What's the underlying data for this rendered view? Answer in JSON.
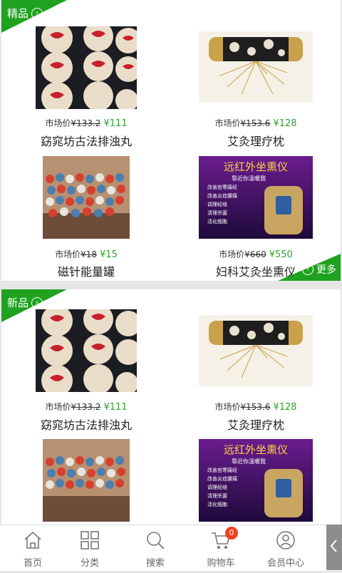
{
  "sections": [
    {
      "label": "精品",
      "more_label": "更多",
      "items": [
        {
          "market_label": "市场价",
          "old_price": "¥133.2",
          "price": "¥111",
          "name": "窈窕坊古法排浊丸",
          "image": "pills-image"
        },
        {
          "market_label": "市场价",
          "old_price": "¥153.6",
          "price": "¥128",
          "name": "艾灸理疗枕",
          "image": "pillow-image"
        },
        {
          "market_label": "市场价",
          "old_price": "¥18",
          "price": "¥15",
          "name": "磁针能量罐",
          "image": "cups-image"
        },
        {
          "market_label": "市场价",
          "old_price": "¥660",
          "price": "¥550",
          "name": "妇科艾灸坐熏仪",
          "image": "device-image"
        }
      ]
    },
    {
      "label": "新品",
      "items": [
        {
          "market_label": "市场价",
          "old_price": "¥133.2",
          "price": "¥111",
          "name": "窈窕坊古法排浊丸",
          "image": "pills-image"
        },
        {
          "market_label": "市场价",
          "old_price": "¥153.6",
          "price": "¥128",
          "name": "艾灸理疗枕",
          "image": "pillow-image"
        },
        {
          "image": "cups-image"
        },
        {
          "image": "device-image"
        }
      ]
    }
  ],
  "promo": {
    "title": "远红外坐熏仪",
    "subtitle": "靠近你温暖我",
    "features": [
      "改善宫寒痛经",
      "改善炎症腰痛",
      "调理经络",
      "清理杀菌",
      "活化细胞"
    ]
  },
  "nav": [
    {
      "label": "首页",
      "icon": "home-icon"
    },
    {
      "label": "分类",
      "icon": "category-grid-icon"
    },
    {
      "label": "搜索",
      "icon": "search-icon"
    },
    {
      "label": "购物车",
      "icon": "cart-icon",
      "badge": "0"
    },
    {
      "label": "会员中心",
      "icon": "user-icon"
    }
  ],
  "colors": {
    "accent": "#1fa21f",
    "price": "#2fa12f",
    "badge": "#f03e1a"
  }
}
